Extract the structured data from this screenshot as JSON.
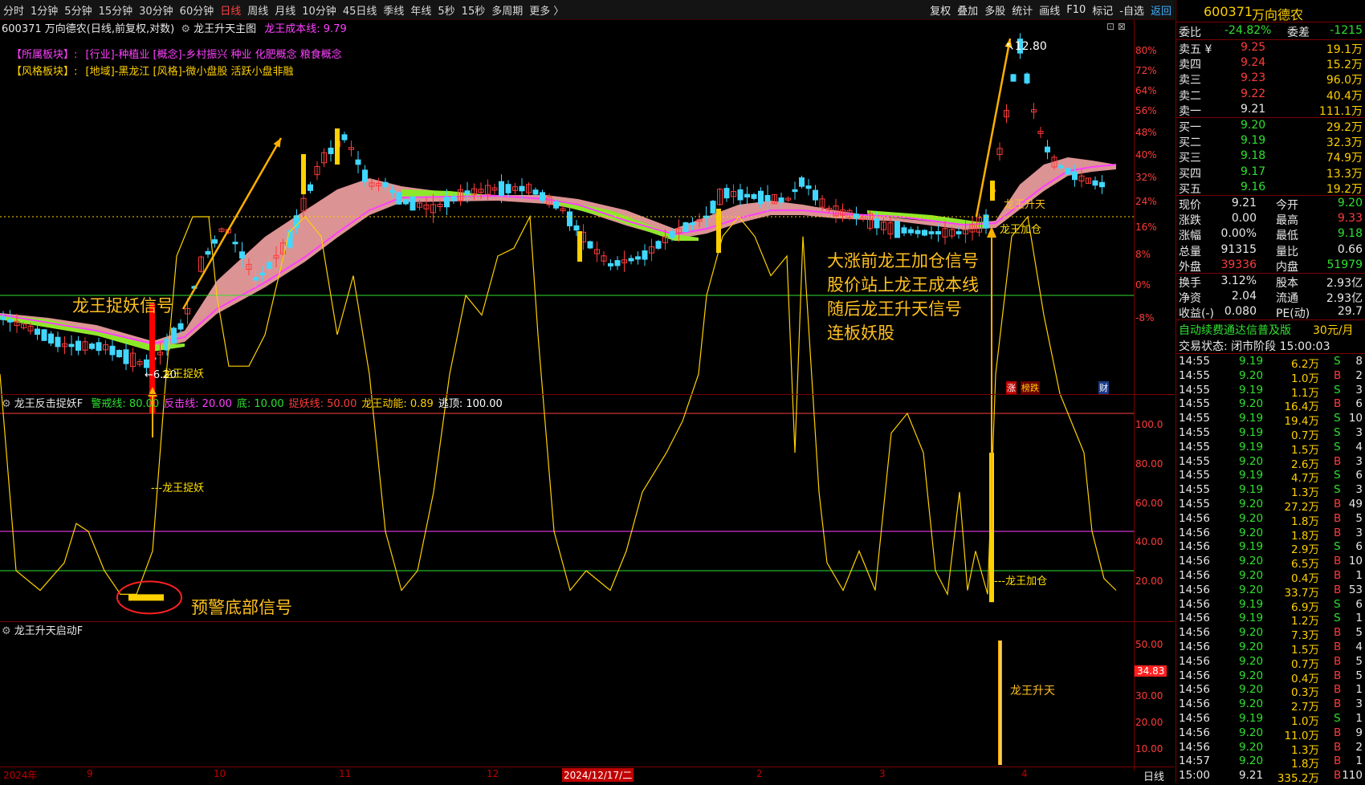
{
  "toolbar": {
    "left_items": [
      "分时",
      "1分钟",
      "5分钟",
      "15分钟",
      "30分钟",
      "60分钟",
      "日线",
      "周线",
      "月线",
      "10分钟",
      "45日线",
      "季线",
      "年线",
      "5秒",
      "15秒",
      "多周期",
      "更多 〉"
    ],
    "active_index": 6,
    "right_items": [
      "复权",
      "叠加",
      "多股",
      "统计",
      "画线",
      "F10",
      "标记",
      "-自选",
      "返回"
    ]
  },
  "main": {
    "title": "600371 万向德农(日线,前复权,对数)",
    "indicator_name": "龙王升天主图",
    "cost_line": "龙王成本线: 9.79",
    "sector_label": "【所属板块】:",
    "sector_value": "[行业]-种植业 [概念]-乡村振兴 种业 化肥概念 粮食概念",
    "style_label": "【风格板块】:",
    "style_value": "[地域]-黑龙江 [风格]-微小盘股 活跃小盘非融",
    "y_labels": [
      "80%",
      "72%",
      "64%",
      "56%",
      "48%",
      "40%",
      "32%",
      "24%",
      "16%",
      "8%",
      "0%",
      "-8%"
    ],
    "high_label": "12.80",
    "low_label": "6.20",
    "tags": {
      "zhang": "涨",
      "bang": "榜跌",
      "cai": "财"
    },
    "annotations": {
      "catch": "龙王捉妖信号",
      "rise": [
        "大涨前龙王加仓信号",
        "股价站上龙王成本线",
        "随后龙王升天信号",
        "连板妖股"
      ],
      "small_catch": "龙王捉妖",
      "small_add": "龙王加仓",
      "small_rise": "龙王升天"
    },
    "colors": {
      "up": "#ff3b3b",
      "down": "#41d7ff",
      "band_pink": "#f4a3a3",
      "band_green": "#8ee82a",
      "cost": "#ff40ff",
      "arrow": "#ffb000"
    }
  },
  "osc": {
    "name": "龙王反击捉妖F",
    "params": [
      {
        "label": "警戒线: 80.00",
        "color": "#2fe02f"
      },
      {
        "label": "反击线: 20.00",
        "color": "#ff40ff"
      },
      {
        "label": "底: 10.00",
        "color": "#2fe02f"
      },
      {
        "label": "捉妖线: 50.00",
        "color": "#ff3b3b"
      },
      {
        "label": "龙王动能: 0.89",
        "color": "#ffd000"
      },
      {
        "label": "逃顶: 100.00",
        "color": "#ffffff"
      }
    ],
    "y_labels": [
      "100.0",
      "80.00",
      "60.00",
      "40.00",
      "20.00"
    ],
    "marker_catch": "---龙王捉妖",
    "marker_add": "---龙王加仓",
    "bottom_signal": "预警底部信号"
  },
  "sub": {
    "name": "龙王升天启动F",
    "y_labels": [
      "50.00",
      "40.00",
      "30.00",
      "20.00",
      "10.00"
    ],
    "current": "34.83",
    "signal": "龙王升天"
  },
  "x_axis": {
    "labels": [
      "2024年",
      "9",
      "10",
      "11",
      "12",
      "2024/12/17/二",
      "2",
      "3",
      "4"
    ],
    "period": "日线"
  },
  "side": {
    "code": "600371",
    "name": "万向德农",
    "weibi_label": "委比",
    "weibi": "-24.82%",
    "weicha_label": "委差",
    "weicha": "-1215",
    "asks": [
      {
        "label": "卖五 ¥",
        "price": "9.25",
        "vol": "19.1万"
      },
      {
        "label": "卖四",
        "price": "9.24",
        "vol": "15.2万"
      },
      {
        "label": "卖三",
        "price": "9.23",
        "vol": "96.0万"
      },
      {
        "label": "卖二",
        "price": "9.22",
        "vol": "40.4万"
      },
      {
        "label": "卖一",
        "price": "9.21",
        "vol": "111.1万"
      }
    ],
    "bids": [
      {
        "label": "买一",
        "price": "9.20",
        "vol": "29.2万"
      },
      {
        "label": "买二",
        "price": "9.19",
        "vol": "32.3万"
      },
      {
        "label": "买三",
        "price": "9.18",
        "vol": "74.9万"
      },
      {
        "label": "买四",
        "price": "9.17",
        "vol": "13.3万"
      },
      {
        "label": "买五",
        "price": "9.16",
        "vol": "19.2万"
      }
    ],
    "stats": [
      {
        "l1": "现价",
        "v1": "9.21",
        "c1": "white",
        "l2": "今开",
        "v2": "9.20",
        "c2": "green"
      },
      {
        "l1": "涨跌",
        "v1": "0.00",
        "c1": "white",
        "l2": "最高",
        "v2": "9.33",
        "c2": "red"
      },
      {
        "l1": "涨幅",
        "v1": "0.00%",
        "c1": "white",
        "l2": "最低",
        "v2": "9.18",
        "c2": "green"
      },
      {
        "l1": "总量",
        "v1": "91315",
        "c1": "white",
        "l2": "量比",
        "v2": "0.66",
        "c2": "white"
      },
      {
        "l1": "外盘",
        "v1": "39336",
        "c1": "red",
        "l2": "内盘",
        "v2": "51979",
        "c2": "green"
      }
    ],
    "stats2": [
      {
        "l1": "换手",
        "v1": "3.12%",
        "l2": "股本",
        "v2": "2.93亿"
      },
      {
        "l1": "净资",
        "v1": "2.04",
        "l2": "流通",
        "v2": "2.93亿"
      },
      {
        "l1": "收益(-)",
        "v1": "0.080",
        "l2": "PE(动)",
        "v2": "29.7"
      }
    ],
    "promo": "自动续费通达信普及版",
    "promo_price": "30元/月",
    "trade_state": "交易状态: 闭市阶段 15:00:03",
    "ticks": [
      [
        "14:55",
        "9.19",
        "6.2万",
        "S",
        "8"
      ],
      [
        "14:55",
        "9.20",
        "1.0万",
        "B",
        "2"
      ],
      [
        "14:55",
        "9.19",
        "1.1万",
        "S",
        "3"
      ],
      [
        "14:55",
        "9.20",
        "16.4万",
        "B",
        "6"
      ],
      [
        "14:55",
        "9.19",
        "19.4万",
        "S",
        "10"
      ],
      [
        "14:55",
        "9.19",
        "0.7万",
        "S",
        "3"
      ],
      [
        "14:55",
        "9.19",
        "1.5万",
        "S",
        "4"
      ],
      [
        "14:55",
        "9.20",
        "2.6万",
        "B",
        "3"
      ],
      [
        "14:55",
        "9.19",
        "4.7万",
        "S",
        "6"
      ],
      [
        "14:55",
        "9.19",
        "1.3万",
        "S",
        "3"
      ],
      [
        "14:55",
        "9.20",
        "27.2万",
        "B",
        "49"
      ],
      [
        "14:56",
        "9.20",
        "1.8万",
        "B",
        "5"
      ],
      [
        "14:56",
        "9.20",
        "1.8万",
        "B",
        "3"
      ],
      [
        "14:56",
        "9.19",
        "2.9万",
        "S",
        "6"
      ],
      [
        "14:56",
        "9.20",
        "6.5万",
        "B",
        "10"
      ],
      [
        "14:56",
        "9.20",
        "0.4万",
        "B",
        "1"
      ],
      [
        "14:56",
        "9.20",
        "33.7万",
        "B",
        "53"
      ],
      [
        "14:56",
        "9.19",
        "6.9万",
        "S",
        "6"
      ],
      [
        "14:56",
        "9.19",
        "1.2万",
        "S",
        "1"
      ],
      [
        "14:56",
        "9.20",
        "7.3万",
        "B",
        "5"
      ],
      [
        "14:56",
        "9.20",
        "1.5万",
        "B",
        "4"
      ],
      [
        "14:56",
        "9.20",
        "0.7万",
        "B",
        "5"
      ],
      [
        "14:56",
        "9.20",
        "0.4万",
        "B",
        "5"
      ],
      [
        "14:56",
        "9.20",
        "0.3万",
        "B",
        "1"
      ],
      [
        "14:56",
        "9.20",
        "2.7万",
        "B",
        "3"
      ],
      [
        "14:56",
        "9.19",
        "1.0万",
        "S",
        "1"
      ],
      [
        "14:56",
        "9.20",
        "11.0万",
        "B",
        "9"
      ],
      [
        "14:56",
        "9.20",
        "1.3万",
        "B",
        "2"
      ],
      [
        "14:57",
        "9.20",
        "1.8万",
        "B",
        "1"
      ],
      [
        "15:00",
        "9.21",
        "335.2万",
        "B",
        "110"
      ]
    ]
  }
}
